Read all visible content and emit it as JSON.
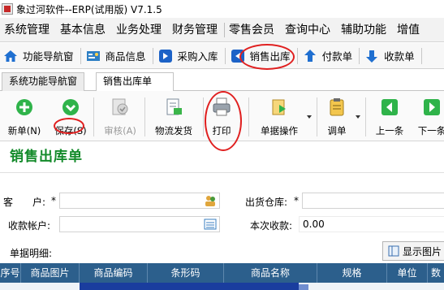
{
  "window": {
    "title": "象过河软件--ERP(试用版) V7.1.5"
  },
  "menu": [
    "系统管理",
    "基本信息",
    "业务处理",
    "财务管理",
    "零售会员",
    "查询中心",
    "辅助功能",
    "增值"
  ],
  "nav": {
    "items": [
      {
        "label": "功能导航窗",
        "icon": "home-icon"
      },
      {
        "label": "商品信息",
        "icon": "product-icon"
      },
      {
        "label": "采购入库",
        "icon": "purchase-icon"
      },
      {
        "label": "销售出库",
        "icon": "sales-out-icon"
      },
      {
        "label": "付款单",
        "icon": "payment-icon"
      },
      {
        "label": "收款单",
        "icon": "receipt-icon"
      }
    ]
  },
  "tabs": [
    "系统功能导航窗",
    "销售出库单"
  ],
  "toolbar": {
    "new": "新单(N)",
    "save": "保存(S)",
    "audit": "审核(A)",
    "logistics": "物流发货",
    "print": "打印",
    "doc_ops": "单据操作",
    "transfer": "调单",
    "prev": "上一条",
    "next": "下一条"
  },
  "form": {
    "title": "销售出库单",
    "customer_label": "客　　户:",
    "required_mark": "*",
    "warehouse_label": "出货仓库:",
    "collect_account_label": "收款帐户:",
    "current_collect_label": "本次收款:",
    "current_collect_value": "0.00",
    "detail_label": "单据明细:",
    "show_image_button": "显示图片"
  },
  "grid": {
    "columns": [
      "序号",
      "商品图片",
      "商品编码",
      "条形码",
      "商品名称",
      "规格",
      "单位",
      "数"
    ]
  },
  "colors": {
    "form_title": "#138a2a",
    "grid_header": "#2c5f8c",
    "annotation": "#e02020"
  }
}
